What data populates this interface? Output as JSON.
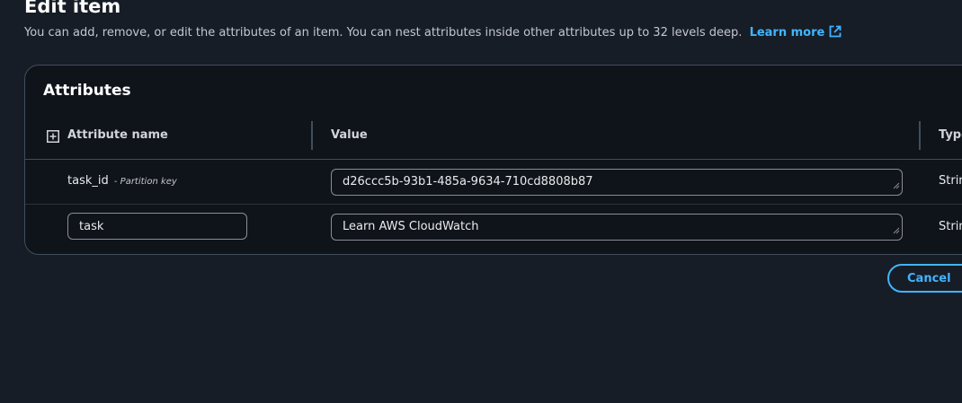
{
  "page": {
    "title": "Edit item",
    "description": "You can add, remove, or edit the attributes of an item. You can nest attributes inside other attributes up to 32 levels deep.",
    "learn_more": "Learn more"
  },
  "attributes": {
    "title": "Attributes",
    "columns": {
      "name": "Attribute name",
      "value": "Value",
      "type": "Type"
    },
    "rows": [
      {
        "name": "task_id",
        "key_label": "- Partition key",
        "value": "d26ccc5b-93b1-485a-9634-710cd8808b87",
        "type": "String"
      },
      {
        "name": "task",
        "value": "Learn AWS CloudWatch",
        "type": "String"
      }
    ]
  },
  "actions": {
    "cancel": "Cancel"
  },
  "icons": {
    "external_link": "external-link-icon",
    "expand": "expand-all-icon",
    "resize": "resize-handle-icon"
  },
  "colors": {
    "background": "#161d26",
    "container": "#0f141a",
    "accent": "#42b4ff",
    "border": "#414d5c"
  }
}
